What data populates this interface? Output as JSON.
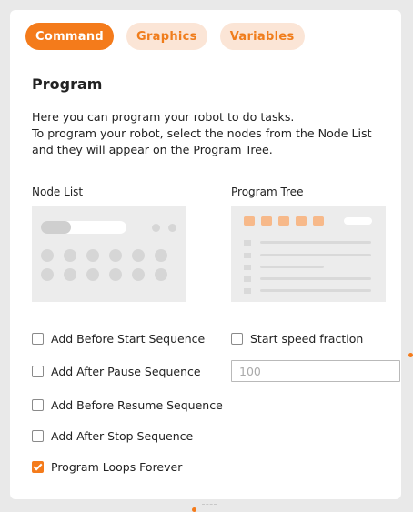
{
  "tabs": [
    {
      "label": "Command",
      "active": true
    },
    {
      "label": "Graphics",
      "active": false
    },
    {
      "label": "Variables",
      "active": false
    }
  ],
  "program": {
    "title": "Program",
    "description": [
      "Here you can program your robot to do tasks.",
      "To program your robot, select the nodes from the Node List",
      "and they will appear on the Program Tree."
    ],
    "node_list_label": "Node List",
    "program_tree_label": "Program Tree"
  },
  "options": {
    "add_before_start": {
      "label": "Add Before Start Sequence",
      "checked": false
    },
    "add_after_pause": {
      "label": "Add After Pause Sequence",
      "checked": false
    },
    "add_before_resume": {
      "label": "Add Before Resume Sequence",
      "checked": false
    },
    "add_after_stop": {
      "label": "Add After Stop Sequence",
      "checked": false
    },
    "program_loops_forever": {
      "label": "Program Loops Forever",
      "checked": true
    },
    "start_speed_fraction": {
      "label": "Start speed fraction",
      "checked": false,
      "placeholder": "100",
      "value": ""
    }
  },
  "colors": {
    "accent": "#f47b1b",
    "accent_light": "#fbe5d6"
  }
}
